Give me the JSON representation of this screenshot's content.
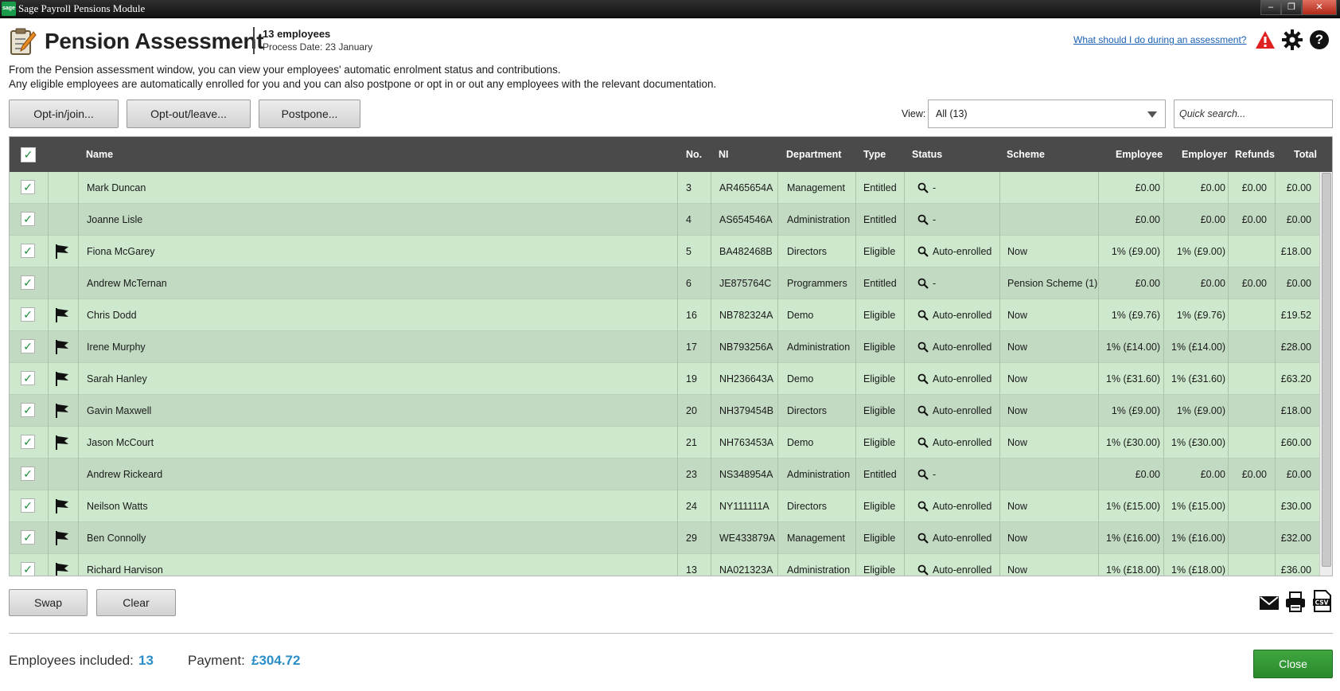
{
  "window": {
    "title": "Sage Payroll Pensions Module",
    "app_badge": "sage"
  },
  "header": {
    "title": "Pension Assessment",
    "employee_count": "13 employees",
    "process_date": "Process Date: 23 January",
    "help_link": "What should I do during an assessment?"
  },
  "intro": {
    "line1": "From the Pension assessment window, you can view your employees' automatic enrolment status and contributions.",
    "line2": "Any eligible employees are automatically enrolled for you and you can also postpone or opt in or out any employees with the relevant documentation."
  },
  "toolbar": {
    "opt_in": "Opt-in/join...",
    "opt_out": "Opt-out/leave...",
    "postpone": "Postpone...",
    "view_label": "View:",
    "view_value": "All (13)",
    "search_placeholder": "Quick search..."
  },
  "table": {
    "columns": {
      "name": "Name",
      "no": "No.",
      "ni": "NI",
      "department": "Department",
      "type": "Type",
      "status": "Status",
      "scheme": "Scheme",
      "employee": "Employee",
      "employer": "Employer",
      "refunds": "Refunds",
      "total": "Total"
    },
    "rows": [
      {
        "checked": true,
        "flag": false,
        "name": "Mark Duncan",
        "no": "3",
        "ni": "AR465654A",
        "department": "Management",
        "type": "Entitled",
        "status": "-",
        "scheme": "",
        "employee": "£0.00",
        "employer": "£0.00",
        "refunds": "£0.00",
        "total": "£0.00"
      },
      {
        "checked": true,
        "flag": false,
        "name": "Joanne Lisle",
        "no": "4",
        "ni": "AS654546A",
        "department": "Administration",
        "type": "Entitled",
        "status": "-",
        "scheme": "",
        "employee": "£0.00",
        "employer": "£0.00",
        "refunds": "£0.00",
        "total": "£0.00"
      },
      {
        "checked": true,
        "flag": true,
        "name": "Fiona McGarey",
        "no": "5",
        "ni": "BA482468B",
        "department": "Directors",
        "type": "Eligible",
        "status": "Auto-enrolled",
        "scheme": "Now",
        "employee": "1% (£9.00)",
        "employer": "1% (£9.00)",
        "refunds": "",
        "total": "£18.00"
      },
      {
        "checked": true,
        "flag": false,
        "name": "Andrew McTernan",
        "no": "6",
        "ni": "JE875764C",
        "department": "Programmers",
        "type": "Entitled",
        "status": "-",
        "scheme": "Pension Scheme (1)",
        "employee": "£0.00",
        "employer": "£0.00",
        "refunds": "£0.00",
        "total": "£0.00"
      },
      {
        "checked": true,
        "flag": true,
        "name": "Chris Dodd",
        "no": "16",
        "ni": "NB782324A",
        "department": "Demo",
        "type": "Eligible",
        "status": "Auto-enrolled",
        "scheme": "Now",
        "employee": "1% (£9.76)",
        "employer": "1% (£9.76)",
        "refunds": "",
        "total": "£19.52"
      },
      {
        "checked": true,
        "flag": true,
        "name": "Irene Murphy",
        "no": "17",
        "ni": "NB793256A",
        "department": "Administration",
        "type": "Eligible",
        "status": "Auto-enrolled",
        "scheme": "Now",
        "employee": "1% (£14.00)",
        "employer": "1% (£14.00)",
        "refunds": "",
        "total": "£28.00"
      },
      {
        "checked": true,
        "flag": true,
        "name": "Sarah Hanley",
        "no": "19",
        "ni": "NH236643A",
        "department": "Demo",
        "type": "Eligible",
        "status": "Auto-enrolled",
        "scheme": "Now",
        "employee": "1% (£31.60)",
        "employer": "1% (£31.60)",
        "refunds": "",
        "total": "£63.20"
      },
      {
        "checked": true,
        "flag": true,
        "name": "Gavin Maxwell",
        "no": "20",
        "ni": "NH379454B",
        "department": "Directors",
        "type": "Eligible",
        "status": "Auto-enrolled",
        "scheme": "Now",
        "employee": "1% (£9.00)",
        "employer": "1% (£9.00)",
        "refunds": "",
        "total": "£18.00"
      },
      {
        "checked": true,
        "flag": true,
        "name": "Jason McCourt",
        "no": "21",
        "ni": "NH763453A",
        "department": "Demo",
        "type": "Eligible",
        "status": "Auto-enrolled",
        "scheme": "Now",
        "employee": "1% (£30.00)",
        "employer": "1% (£30.00)",
        "refunds": "",
        "total": "£60.00"
      },
      {
        "checked": true,
        "flag": false,
        "name": "Andrew Rickeard",
        "no": "23",
        "ni": "NS348954A",
        "department": "Administration",
        "type": "Entitled",
        "status": "-",
        "scheme": "",
        "employee": "£0.00",
        "employer": "£0.00",
        "refunds": "£0.00",
        "total": "£0.00"
      },
      {
        "checked": true,
        "flag": true,
        "name": "Neilson Watts",
        "no": "24",
        "ni": "NY111111A",
        "department": "Directors",
        "type": "Eligible",
        "status": "Auto-enrolled",
        "scheme": "Now",
        "employee": "1% (£15.00)",
        "employer": "1% (£15.00)",
        "refunds": "",
        "total": "£30.00"
      },
      {
        "checked": true,
        "flag": true,
        "name": "Ben Connolly",
        "no": "29",
        "ni": "WE433879A",
        "department": "Management",
        "type": "Eligible",
        "status": "Auto-enrolled",
        "scheme": "Now",
        "employee": "1% (£16.00)",
        "employer": "1% (£16.00)",
        "refunds": "",
        "total": "£32.00"
      },
      {
        "checked": true,
        "flag": true,
        "name": "Richard Harvison",
        "no": "13",
        "ni": "NA021323A",
        "department": "Administration",
        "type": "Eligible",
        "status": "Auto-enrolled",
        "scheme": "Now",
        "employee": "1% (£18.00)",
        "employer": "1% (£18.00)",
        "refunds": "",
        "total": "£36.00"
      }
    ]
  },
  "actions": {
    "swap": "Swap",
    "clear": "Clear",
    "close": "Close"
  },
  "footer": {
    "employees_included_label": "Employees included:",
    "employees_included_value": "13",
    "payment_label": "Payment:",
    "payment_value": "£304.72"
  },
  "icons": {
    "header": "assessment-clipboard-icon",
    "warning": "warning-icon",
    "settings": "gear-icon",
    "help": "help-icon",
    "email": "email-icon",
    "print": "print-icon",
    "export": "csv-icon",
    "flag": "flag-icon",
    "status": "magnifier-icon"
  },
  "colors": {
    "row_odd": "#cde8cd",
    "row_even": "#c2d9c2",
    "header_bg": "#4a4a4a",
    "accent": "#2a8ec8",
    "close_button": "#2e8f30",
    "warning": "#e02020"
  }
}
